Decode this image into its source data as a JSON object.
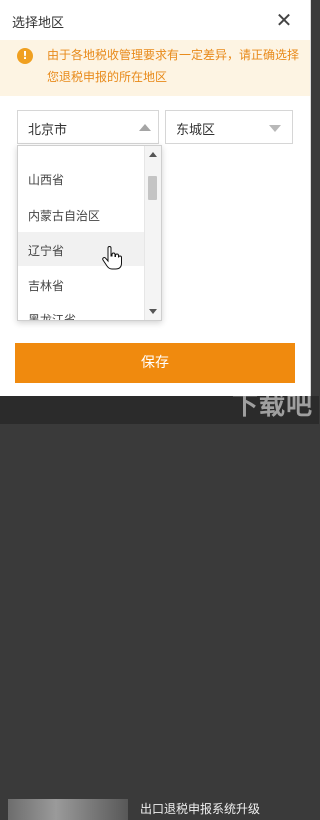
{
  "dialog": {
    "title": "选择地区",
    "close_glyph": "✕",
    "notice": {
      "icon": "warning-icon",
      "icon_glyph": "!",
      "text": "由于各地税收管理要求有一定差异，请正确选择您退税申报的所在地区"
    },
    "city_select": {
      "value": "北京市",
      "state": "open"
    },
    "district_select": {
      "value": "东城区"
    },
    "dropdown": {
      "options": [
        "山西省",
        "内蒙古自治区",
        "辽宁省",
        "吉林省",
        "黑龙江省"
      ],
      "hovered_index": 2
    },
    "save_label": "保存"
  },
  "background": {
    "item_title": "出口退税申报系统升级",
    "watermark": "下载吧"
  },
  "colors": {
    "accent": "#f08a0e",
    "notice_bg": "#fdf4e3",
    "notice_text": "#e88a1a"
  }
}
